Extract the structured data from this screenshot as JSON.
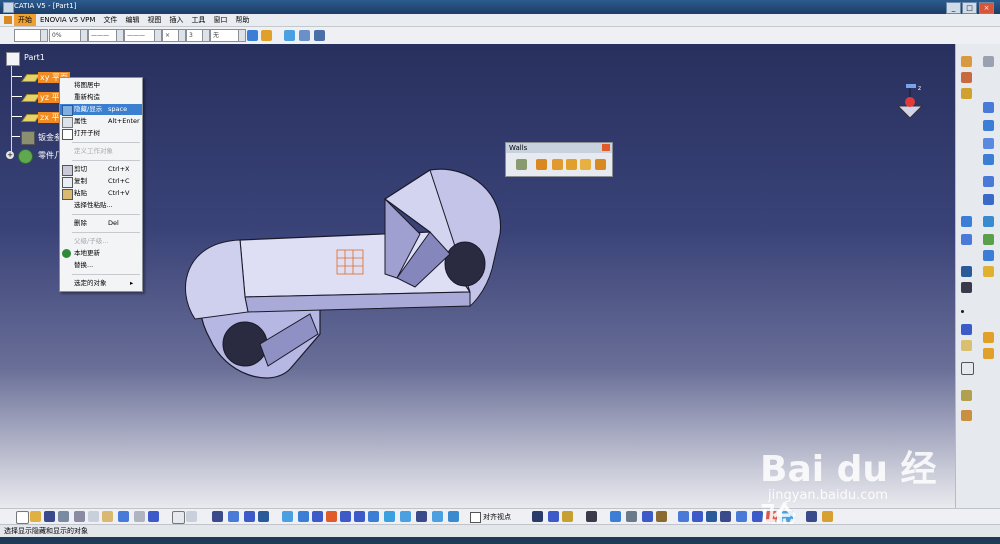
{
  "window": {
    "title": "CATIA V5 - [Part1]",
    "buttons": [
      "_",
      "□",
      "×"
    ]
  },
  "menubar": {
    "items": [
      "开始",
      "ENOVIA V5 VPM",
      "文件",
      "编辑",
      "视图",
      "插入",
      "工具",
      "窗口",
      "帮助"
    ],
    "active": 0
  },
  "toolbar_top": {
    "combos": [
      "",
      "0%",
      "———",
      "———",
      "×",
      "3",
      "无"
    ]
  },
  "tree": {
    "root": "Part1",
    "nodes": [
      {
        "label": "xy 平面",
        "icon": "plane-icon"
      },
      {
        "label": "yz 平面",
        "icon": "plane-icon"
      },
      {
        "label": "zx 平面",
        "icon": "plane-icon"
      },
      {
        "label": "钣金参数",
        "icon": "sheet-metal-icon"
      },
      {
        "label": "零件几何体",
        "icon": "gear-body-icon"
      }
    ]
  },
  "context_menu": {
    "items": [
      {
        "label": "将图居中",
        "shortcut": "",
        "icon": "",
        "state": "normal"
      },
      {
        "label": "重新构造",
        "shortcut": "",
        "icon": "",
        "state": "normal"
      },
      {
        "label": "隐藏/显示",
        "shortcut": "space",
        "icon": "hide-show-icon",
        "state": "selected"
      },
      {
        "label": "属性",
        "shortcut": "Alt+Enter",
        "icon": "properties-icon",
        "state": "normal"
      },
      {
        "label": "打开子树",
        "shortcut": "",
        "icon": "open-subtree-icon",
        "state": "normal"
      },
      {
        "label": "定义工作对象",
        "shortcut": "",
        "icon": "",
        "state": "disabled"
      },
      {
        "label": "剪切",
        "shortcut": "Ctrl+X",
        "icon": "cut-icon",
        "state": "normal"
      },
      {
        "label": "复制",
        "shortcut": "Ctrl+C",
        "icon": "copy-icon",
        "state": "normal"
      },
      {
        "label": "粘贴",
        "shortcut": "Ctrl+V",
        "icon": "paste-icon",
        "state": "normal"
      },
      {
        "label": "选择性粘贴...",
        "shortcut": "",
        "icon": "",
        "state": "normal"
      },
      {
        "label": "删除",
        "shortcut": "Del",
        "icon": "",
        "state": "normal"
      },
      {
        "label": "父级/子级...",
        "shortcut": "",
        "icon": "",
        "state": "disabled"
      },
      {
        "label": "本地更新",
        "shortcut": "",
        "icon": "local-update-icon",
        "state": "normal"
      },
      {
        "label": "替换...",
        "shortcut": "",
        "icon": "",
        "state": "normal"
      },
      {
        "label": "选定的对象",
        "shortcut": "▸",
        "icon": "",
        "state": "normal"
      }
    ]
  },
  "walls_toolbar": {
    "title": "Walls"
  },
  "bottom_toolbar": {
    "checkbox_label": "对齐视点"
  },
  "status": {
    "text": "选择显示隐藏和显示的对象"
  },
  "compass": {
    "label": "z"
  },
  "watermark": {
    "main": "Bai du 经验",
    "sub": "jingyan.baidu.com"
  },
  "colors": {
    "highlight": "#f08c24",
    "selected": "#3b7fd0",
    "part_face": "#d9daf2"
  }
}
